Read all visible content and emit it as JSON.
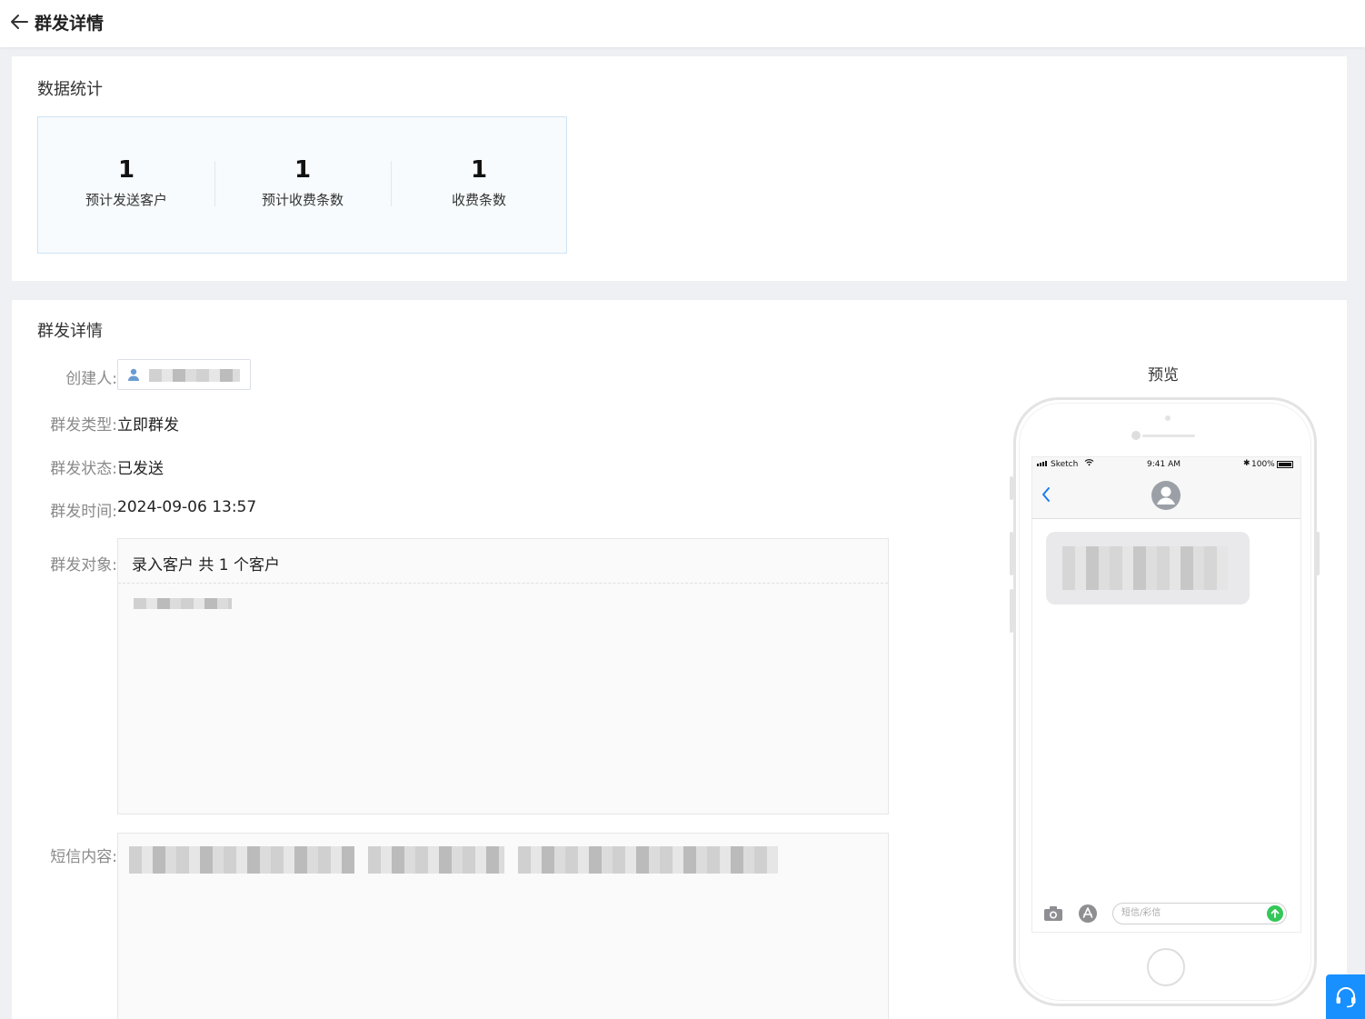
{
  "header": {
    "title": "群发详情"
  },
  "stats": {
    "title": "数据统计",
    "items": [
      {
        "value": "1",
        "label": "预计发送客户"
      },
      {
        "value": "1",
        "label": "预计收费条数"
      },
      {
        "value": "1",
        "label": "收费条数"
      }
    ]
  },
  "detail": {
    "title": "群发详情",
    "creator_label": "创建人:",
    "type_label": "群发类型:",
    "type_value": "立即群发",
    "status_label": "群发状态:",
    "status_value": "已发送",
    "time_label": "群发时间:",
    "time_value": "2024-09-06 13:57",
    "target_label": "群发对象:",
    "target_summary": "录入客户 共 1 个客户",
    "content_label": "短信内容:"
  },
  "preview": {
    "label": "预览",
    "carrier": "Sketch",
    "time": "9:41 AM",
    "battery": "100%",
    "input_placeholder": "短信/彩信"
  },
  "colors": {
    "accent": "#1890ff",
    "send_green": "#34c759",
    "back_blue": "#1a7cf0"
  },
  "icons": [
    "back-arrow-icon",
    "user-icon",
    "camera-icon",
    "app-store-icon",
    "send-icon",
    "headset-icon"
  ]
}
